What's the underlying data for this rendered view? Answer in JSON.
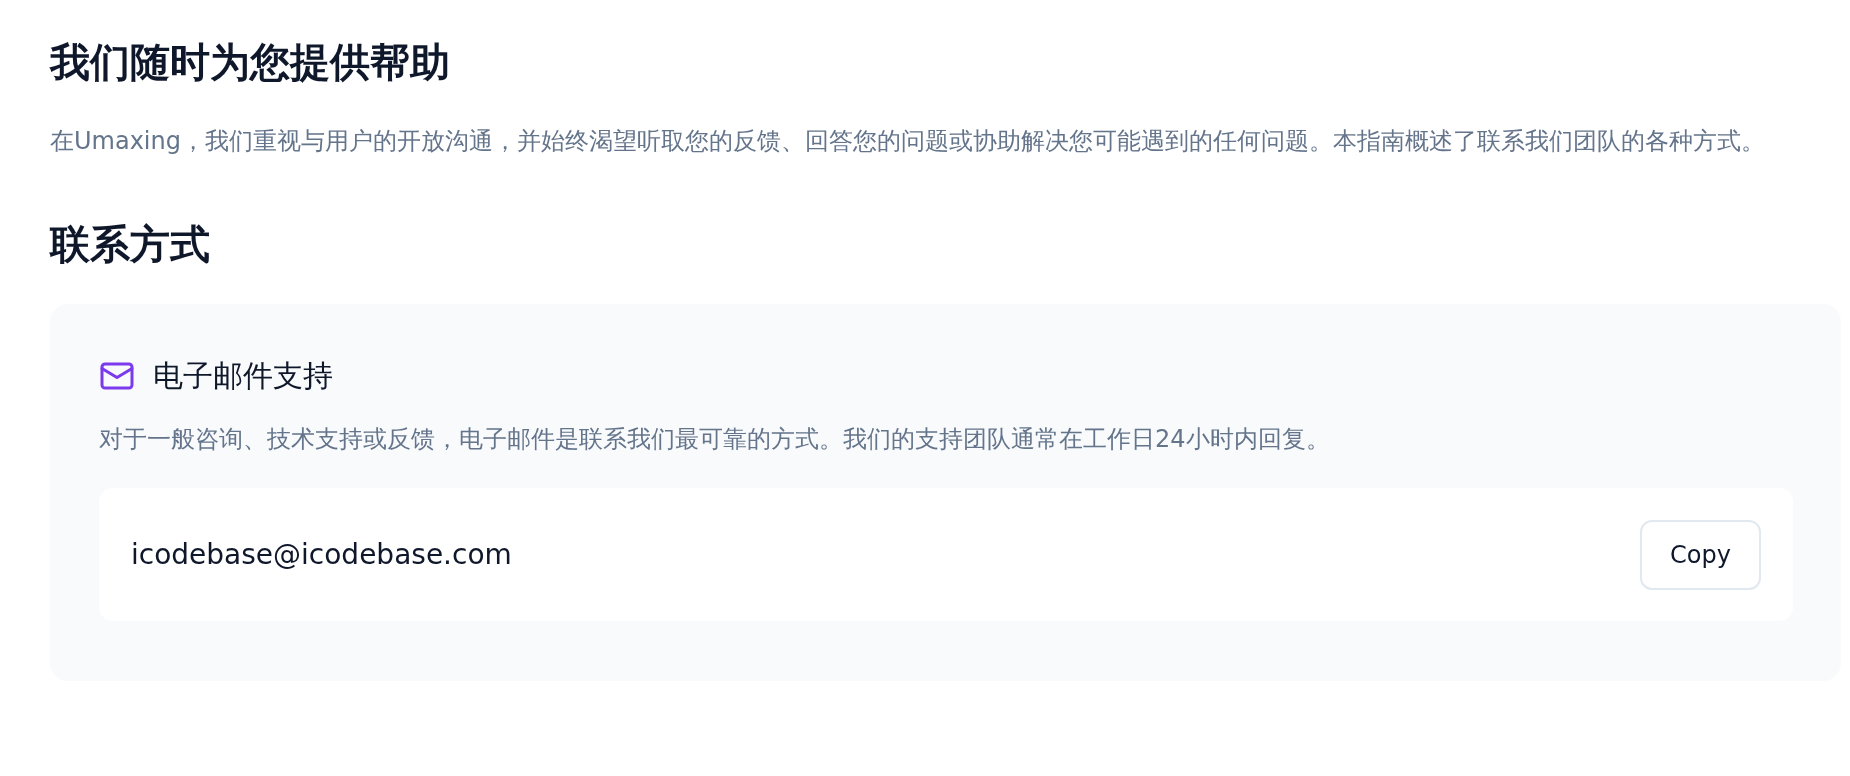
{
  "heading": "我们随时为您提供帮助",
  "intro": "在Umaxing，我们重视与用户的开放沟通，并始终渴望听取您的反馈、回答您的问题或协助解决您可能遇到的任何问题。本指南概述了联系我们团队的各种方式。",
  "section_title": "联系方式",
  "cards": [
    {
      "kind": "email",
      "title": "电子邮件支持",
      "description": "对于一般咨询、技术支持或反馈，电子邮件是联系我们最可靠的方式。我们的支持团队通常在工作日24小时内回复。",
      "value": "icodebase@icodebase.com",
      "button": "Copy"
    }
  ]
}
